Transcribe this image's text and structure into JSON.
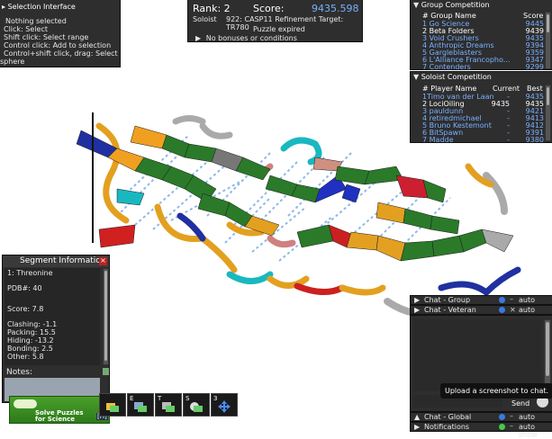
{
  "selection": {
    "title": "Selection Interface",
    "lines": [
      "Nothing selected",
      "Click: Select",
      "Shift click: Select range",
      "Control click: Add to selection",
      "Control+shift click, drag: Select",
      "sphere"
    ]
  },
  "score_panel": {
    "rank_label": "Rank: 2",
    "score_label": "Score:",
    "score_value": "9435.598",
    "soloist": "Soloist",
    "puzzle_line": "922: CASP11 Refinement Target: TR780",
    "status": "Puzzle expired",
    "bonus": "No bonuses or conditions"
  },
  "group_comp": {
    "title": "Group Competition",
    "col_name": "# Group Name",
    "col_score": "Score",
    "rows": [
      {
        "name": "1 Go Science",
        "score": "9445",
        "hl": false
      },
      {
        "name": "2 Beta Folders",
        "score": "9439",
        "hl": true
      },
      {
        "name": "3 Void Crushers",
        "score": "9435",
        "hl": false
      },
      {
        "name": "4 Anthropic Dreams",
        "score": "9394",
        "hl": false
      },
      {
        "name": "5 Gargleblasters",
        "score": "9359",
        "hl": false
      },
      {
        "name": "6 L'Alliance Francopho...",
        "score": "9347",
        "hl": false
      },
      {
        "name": "7 Contenders",
        "score": "9299",
        "hl": false
      }
    ]
  },
  "solo_comp": {
    "title": "Soloist Competition",
    "col_name": "# Player Name",
    "col_current": "Current",
    "col_best": "Best",
    "rows": [
      {
        "name": "1Timo van der Laan",
        "current": "-",
        "best": "9435",
        "hl": false
      },
      {
        "name": "2 LociOiling",
        "current": "9435",
        "best": "9435",
        "hl": true
      },
      {
        "name": "3 pauldunn",
        "current": "-",
        "best": "9421",
        "hl": false
      },
      {
        "name": "4 retiredmichael",
        "current": "-",
        "best": "9413",
        "hl": false
      },
      {
        "name": "5 Bruno Kestemont",
        "current": "-",
        "best": "9412",
        "hl": false
      },
      {
        "name": "6 BitSpawn",
        "current": "-",
        "best": "9391",
        "hl": false
      },
      {
        "name": "7 Madde",
        "current": "-",
        "best": "9380",
        "hl": false
      }
    ]
  },
  "segment": {
    "title": "Segment Information",
    "residue": "1: Threonine",
    "pdb": "PDB#:  40",
    "score": "Score: 7.8",
    "clashing": "Clashing: -1.1",
    "packing": "Packing: 15.5",
    "hiding": "Hiding: -13.2",
    "bonding": "Bonding: 2.5",
    "other": "Other: 5.8",
    "notes_label": "Notes:",
    "close": "×"
  },
  "chat": {
    "group": "Chat - Group",
    "veteran": "Chat - Veteran",
    "global": "Chat - Global",
    "notifications": "Notifications",
    "auto_show": "auto show",
    "tooltip": "Upload a screenshot to chat.",
    "send": "Send"
  },
  "logo": {
    "tagline": "Solve Puzzles for Science",
    "h": "[H]"
  },
  "tools": [
    {
      "key": "",
      "icon": "shake-icon"
    },
    {
      "key": "E",
      "icon": "wiggle-icon"
    },
    {
      "key": "T",
      "icon": "tweak-icon"
    },
    {
      "key": "S",
      "icon": "shake-sidechain-icon"
    },
    {
      "key": "3",
      "icon": "move-icon"
    }
  ],
  "colors": {
    "panel": "#1e1e1e",
    "accent_blue": "#7ab0ff",
    "logo_green": "#3a8a20"
  }
}
